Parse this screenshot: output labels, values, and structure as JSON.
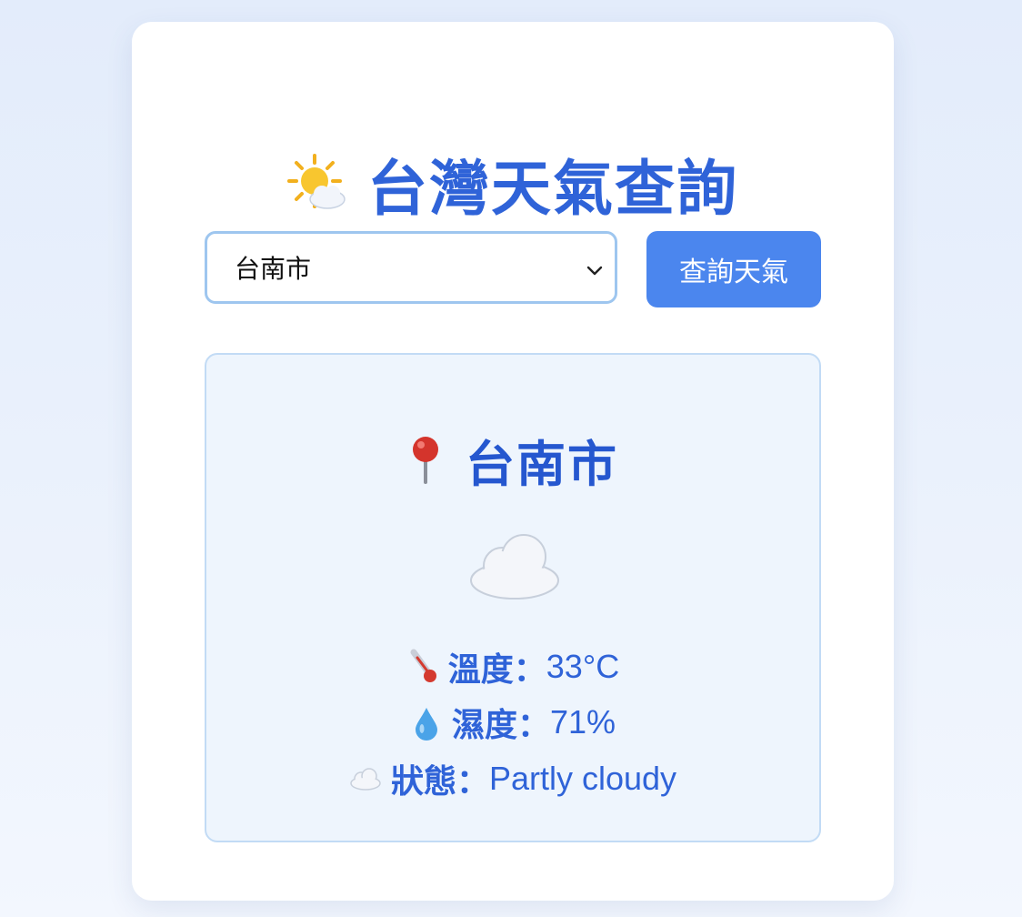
{
  "app": {
    "title": "台灣天氣查詢",
    "title_icon": "sun-behind-cloud-icon"
  },
  "controls": {
    "city_select": {
      "selected": "台南市",
      "icon": "chevron-down-icon"
    },
    "query_button_label": "查詢天氣"
  },
  "result": {
    "pin_icon": "round-pushpin-icon",
    "city": "台南市",
    "weather_icon": "cloud-icon",
    "temperature": {
      "icon": "thermometer-icon",
      "label": "溫度：",
      "value": "33°C"
    },
    "humidity": {
      "icon": "droplet-icon",
      "label": "濕度：",
      "value": "71%"
    },
    "status": {
      "icon": "cloud-icon",
      "label": "狀態：",
      "value": "Partly cloudy"
    }
  },
  "colors": {
    "accent": "#2f63d8",
    "button": "#4b86ee",
    "panel_bg": "#eef5fd",
    "panel_border": "#c2dbf5"
  }
}
